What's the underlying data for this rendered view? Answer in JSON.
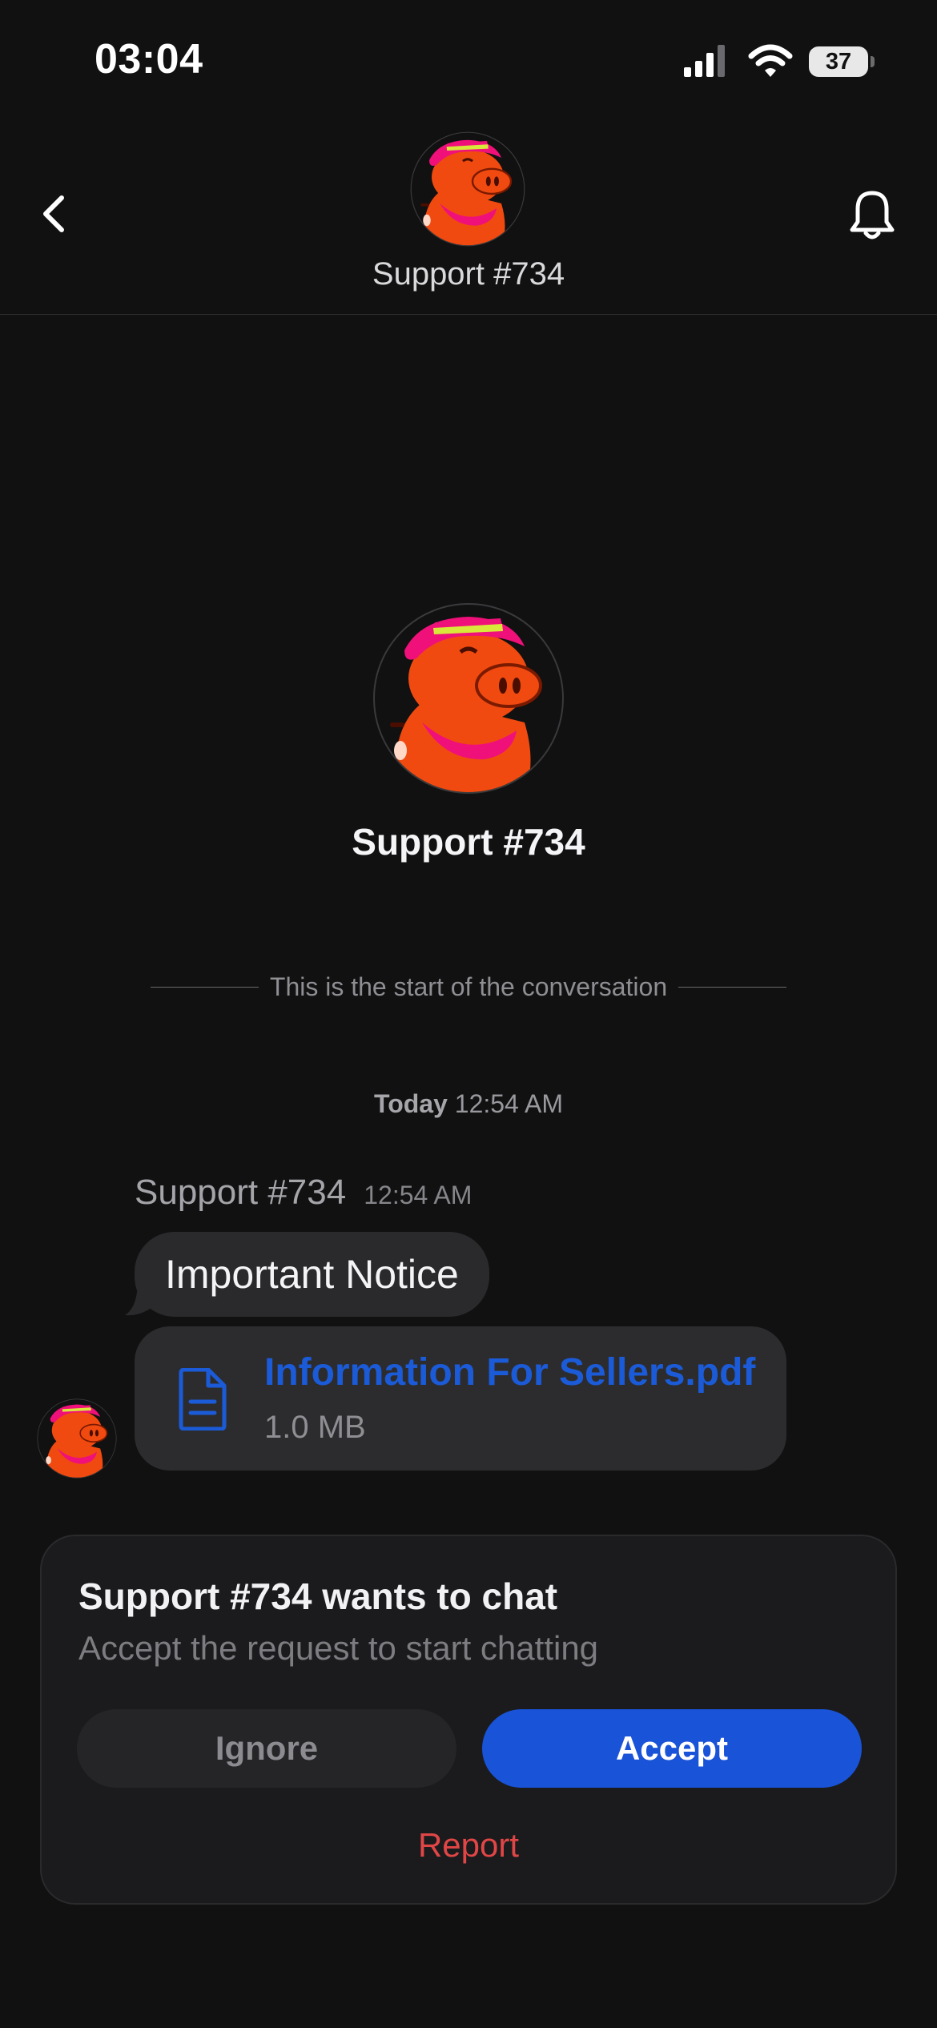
{
  "status_bar": {
    "time": "03:04",
    "battery": "37"
  },
  "header": {
    "title": "Support #734",
    "back_icon": "chevron-left-icon",
    "bell_icon": "bell-icon"
  },
  "profile": {
    "name": "Support #734"
  },
  "conversation": {
    "start_text": "This is the start of the conversation",
    "date_day": "Today",
    "date_time": "12:54 AM"
  },
  "message": {
    "sender": "Support #734",
    "time": "12:54 AM",
    "text": "Important Notice",
    "attachment": {
      "name": "Information For Sellers.pdf",
      "size": "1.0 MB",
      "icon": "document-icon"
    }
  },
  "request": {
    "title": "Support #734 wants to chat",
    "subtitle": "Accept the request to start chatting",
    "ignore_label": "Ignore",
    "accept_label": "Accept",
    "report_label": "Report"
  },
  "colors": {
    "background": "#111112",
    "accent": "#1953d8",
    "danger": "#e04646",
    "link": "#1b5bd7"
  }
}
